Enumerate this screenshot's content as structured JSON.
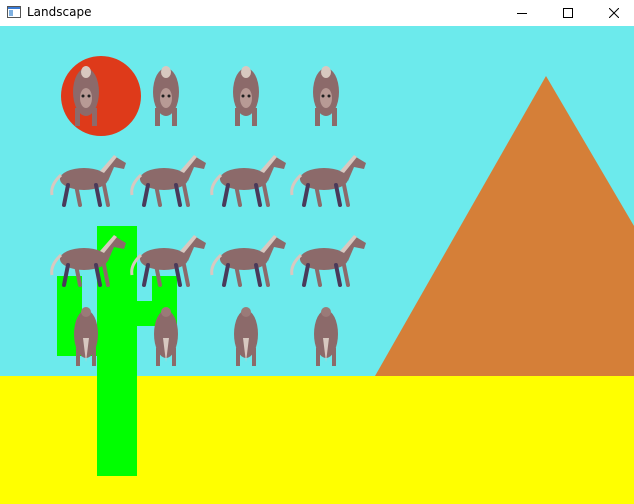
{
  "window": {
    "title": "Landscape",
    "icon": "window-app-icon",
    "controls": [
      "minimize-icon",
      "maximize-icon",
      "close-icon"
    ]
  },
  "scene": {
    "colors": {
      "sky": "#6ceaec",
      "ground": "#ffff00",
      "sun": "#de3a1a",
      "mountain": "#d57f38",
      "cactus": "#00ff00",
      "horse_body": "#8c6a6a",
      "horse_dark": "#4a3a5a",
      "horse_mane": "#d8c8c0"
    },
    "horse_rows": [
      {
        "pose": "front",
        "count": 4
      },
      {
        "pose": "side-walk",
        "count": 4
      },
      {
        "pose": "side-walk",
        "count": 4
      },
      {
        "pose": "back",
        "count": 4
      }
    ]
  }
}
